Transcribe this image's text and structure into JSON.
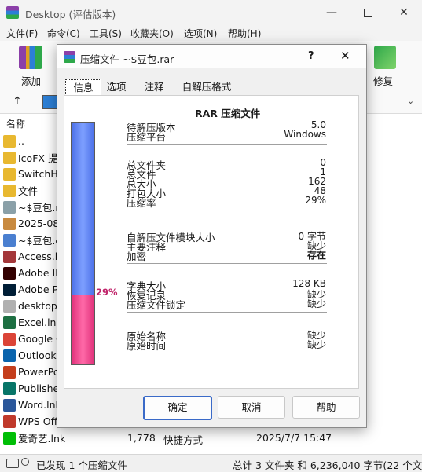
{
  "window": {
    "title": "Desktop (评估版本)"
  },
  "menu": [
    "文件(F)",
    "命令(C)",
    "工具(S)",
    "收藏夹(O)",
    "选项(N)",
    "帮助(H)"
  ],
  "toolbar": {
    "add_label": "添加",
    "repair_label": "修复"
  },
  "filelist": {
    "col_name": "名称",
    "rows": [
      {
        "name": "..",
        "icon": "folder-icon",
        "color": "#e8b830"
      },
      {
        "name": "IcoFX-提",
        "icon": "folder-icon",
        "color": "#e8b830"
      },
      {
        "name": "SwitchHo",
        "icon": "folder-icon",
        "color": "#e8b830"
      },
      {
        "name": "文件",
        "icon": "folder-icon",
        "color": "#e8b830"
      },
      {
        "name": "~$豆包.r",
        "icon": "archive-icon",
        "color": "#8aa0a8"
      },
      {
        "name": "2025-08-",
        "icon": "image-icon",
        "color": "#c88a40"
      },
      {
        "name": "~$豆包.d",
        "icon": "word-icon",
        "color": "#4a7fd0"
      },
      {
        "name": "Access.ln",
        "icon": "access-icon",
        "color": "#a4373a"
      },
      {
        "name": "Adobe Ill",
        "icon": "illustrator-icon",
        "color": "#330000"
      },
      {
        "name": "Adobe Ph",
        "icon": "photoshop-icon",
        "color": "#001e36"
      },
      {
        "name": "desktop.",
        "icon": "settings-file-icon",
        "color": "#b0b0b0"
      },
      {
        "name": "Excel.lnk",
        "icon": "excel-icon",
        "color": "#1d6f42"
      },
      {
        "name": "Google C",
        "icon": "chrome-icon",
        "color": "#db4437"
      },
      {
        "name": "Outlook.",
        "icon": "outlook-icon",
        "color": "#0a64ad"
      },
      {
        "name": "PowerPo",
        "icon": "powerpoint-icon",
        "color": "#c43e1c"
      },
      {
        "name": "Publishe",
        "icon": "publisher-icon",
        "color": "#077568"
      },
      {
        "name": "Word.lnk",
        "icon": "word-icon",
        "color": "#2b579a"
      },
      {
        "name": "WPS Offi",
        "icon": "wps-icon",
        "color": "#c0392b"
      },
      {
        "name": "爱奇艺.lnk",
        "icon": "iqiyi-icon",
        "color": "#00be06",
        "size": "1,778",
        "type": "快捷方式",
        "date": "2025/7/7 15:47"
      }
    ]
  },
  "statusbar": {
    "left": "已发现 1 个压缩文件",
    "right": "总计 3 文件夹 和 6,236,040 字节(22 个文"
  },
  "dialog": {
    "title": "压缩文件 ~$豆包.rar",
    "help": "?",
    "tabs": [
      "信息",
      "选项",
      "注释",
      "自解压格式"
    ],
    "header": "RAR 压缩文件",
    "percent": "29%",
    "groups": [
      [
        {
          "label": "待解压版本",
          "value": "5.0"
        },
        {
          "label": "压缩平台",
          "value": "Windows"
        }
      ],
      [
        {
          "label": "总文件夹",
          "value": "0"
        },
        {
          "label": "总文件",
          "value": "1"
        },
        {
          "label": "总大小",
          "value": "162"
        },
        {
          "label": "打包大小",
          "value": "48"
        },
        {
          "label": "压缩率",
          "value": "29%"
        }
      ],
      [
        {
          "label": "自解压文件模块大小",
          "value": "0 字节"
        },
        {
          "label": "主要注释",
          "value": "缺少"
        },
        {
          "label": "加密",
          "value": "存在"
        }
      ],
      [
        {
          "label": "字典大小",
          "value": "128 KB"
        },
        {
          "label": "恢复记录",
          "value": "缺少"
        },
        {
          "label": "压缩文件锁定",
          "value": "缺少"
        }
      ],
      [
        {
          "label": "原始名称",
          "value": "缺少"
        },
        {
          "label": "原始时间",
          "value": "缺少"
        }
      ]
    ],
    "buttons": {
      "ok": "确定",
      "cancel": "取消",
      "help": "帮助"
    }
  }
}
